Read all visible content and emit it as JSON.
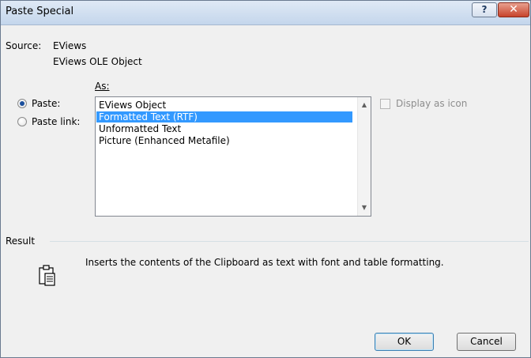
{
  "window": {
    "title": "Paste Special"
  },
  "titlebar": {
    "help_label": "?",
    "close_label": "✕"
  },
  "source": {
    "label": "Source:",
    "line1": "EViews",
    "line2": "EViews OLE Object"
  },
  "as_label": "As:",
  "options": {
    "paste": {
      "label": "Paste:",
      "selected": true
    },
    "paste_link": {
      "label": "Paste link:",
      "selected": false
    }
  },
  "list": {
    "items": [
      "EViews Object",
      "Formatted Text (RTF)",
      "Unformatted Text",
      "Picture (Enhanced Metafile)"
    ],
    "selected_index": 1,
    "scroll_up": "▲",
    "scroll_down": "▼"
  },
  "display_as_icon": {
    "label": "Display as icon",
    "checked": false,
    "enabled": false
  },
  "result": {
    "label": "Result",
    "text": "Inserts the contents of the Clipboard as text with font and table formatting.",
    "icon": "clipboard-icon"
  },
  "buttons": {
    "ok": "OK",
    "cancel": "Cancel"
  },
  "colors": {
    "selection": "#3399ff",
    "radio_dot": "#1b4f9c",
    "close_button": "#c7432b"
  }
}
